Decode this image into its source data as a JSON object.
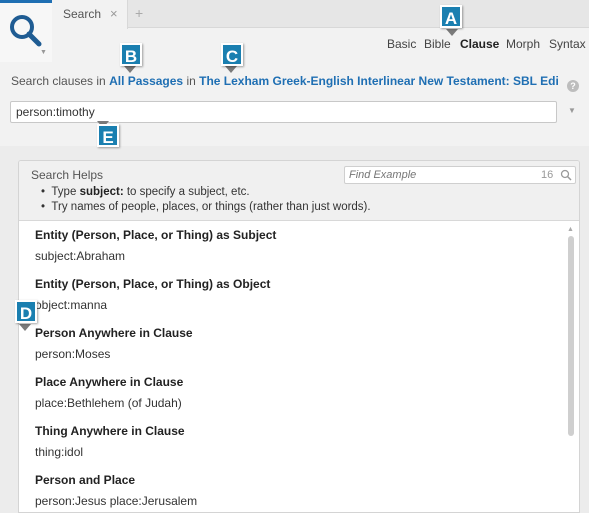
{
  "tabs": {
    "search_tab_label": "Search",
    "close_glyph": "×",
    "add_glyph": "+"
  },
  "modes": [
    "Basic",
    "Bible",
    "Clause",
    "Morph",
    "Syntax"
  ],
  "active_mode": "Clause",
  "scope": {
    "prefix": "Search clauses in ",
    "passages_link": "All Passages",
    "middle": " in ",
    "resource_link": "The Lexham Greek-English Interlinear New Testament: SBL Editi"
  },
  "query": {
    "value": "person:timothy"
  },
  "search_helps": {
    "title": "Search Helps",
    "find_placeholder": "Find Example",
    "find_count": "16",
    "tips": [
      {
        "pre": "Type ",
        "bold": "subject:",
        "post": " to specify a subject, etc."
      },
      {
        "pre": "Try names of people, places, or things (rather than just words).",
        "bold": "",
        "post": ""
      }
    ]
  },
  "examples": [
    {
      "title": "Entity (Person, Place, or Thing) as Subject",
      "sample": "subject:Abraham"
    },
    {
      "title": "Entity (Person, Place, or Thing) as Object",
      "sample": "object:manna"
    },
    {
      "title": "Person Anywhere in Clause",
      "sample": "person:Moses"
    },
    {
      "title": "Place Anywhere in Clause",
      "sample": "place:Bethlehem (of Judah)"
    },
    {
      "title": "Thing Anywhere in Clause",
      "sample": "thing:idol"
    },
    {
      "title": "Person and Place",
      "sample": "person:Jesus place:Jerusalem"
    }
  ],
  "callouts": [
    "A",
    "B",
    "C",
    "D",
    "E"
  ],
  "icons": {
    "app": "search-icon",
    "help": "help-icon",
    "bullet": "•"
  },
  "colors": {
    "accent": "#1f6fb3",
    "badge": "#1a7fb0"
  }
}
